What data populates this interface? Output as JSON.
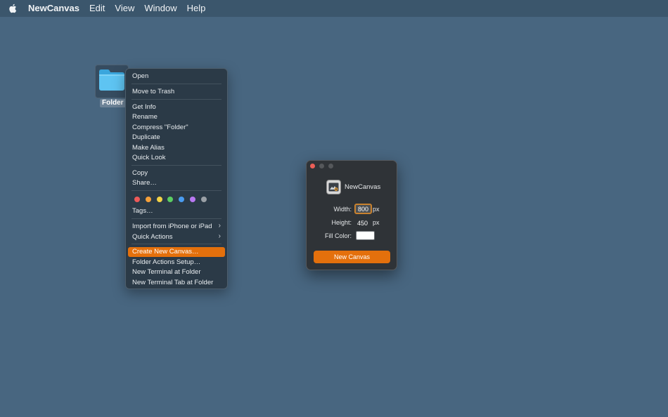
{
  "menubar": {
    "app_name": "NewCanvas",
    "items": [
      "Edit",
      "View",
      "Window",
      "Help"
    ]
  },
  "desktop": {
    "folder_label": "Folder"
  },
  "context_menu": {
    "open": "Open",
    "move_to_trash": "Move to Trash",
    "get_info": "Get Info",
    "rename": "Rename",
    "compress": "Compress \"Folder\"",
    "duplicate": "Duplicate",
    "make_alias": "Make Alias",
    "quick_look": "Quick Look",
    "copy": "Copy",
    "share": "Share…",
    "tags": "Tags…",
    "tag_colors": [
      "#ee5a59",
      "#f5a03a",
      "#f3d247",
      "#5bcd62",
      "#4a9cf0",
      "#b878f2",
      "#9aa0a6"
    ],
    "import_from_iphone": "Import from iPhone or iPad",
    "quick_actions": "Quick Actions",
    "create_new_canvas": "Create New Canvas…",
    "folder_actions_setup": "Folder Actions Setup…",
    "new_terminal": "New Terminal at Folder",
    "new_terminal_tab": "New Terminal Tab at Folder",
    "highlight_color": "#e4700c"
  },
  "dialog": {
    "title": "NewCanvas",
    "width_label": "Width:",
    "width_value": "800",
    "height_label": "Height:",
    "height_value": "450",
    "unit": "px",
    "fill_label": "Fill Color:",
    "fill_color": "#ffffff",
    "button_label": "New Canvas",
    "traffic_lights": [
      "#ec5f57",
      "#55585b",
      "#55585b"
    ]
  }
}
